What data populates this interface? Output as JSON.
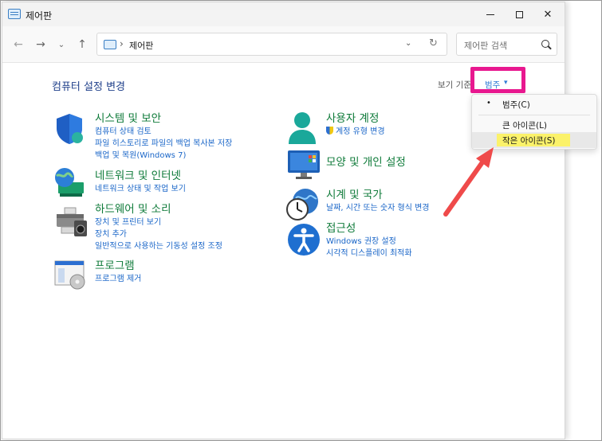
{
  "window": {
    "title": "제어판"
  },
  "nav": {
    "address_path": "제어판",
    "search_placeholder": "제어판 검색"
  },
  "main": {
    "heading": "컴퓨터 설정 변경",
    "view_by_label": "보기 기준:",
    "view_by_value": "범주"
  },
  "categories_left": [
    {
      "title": "시스템 및 보안",
      "links": [
        "컴퓨터 상태 검토",
        "파일 히스토리로 파일의 백업 복사본 저장",
        "백업 및 복원(Windows 7)"
      ]
    },
    {
      "title": "네트워크 및 인터넷",
      "links": [
        "네트워크 상태 및 작업 보기"
      ]
    },
    {
      "title": "하드웨어 및 소리",
      "links": [
        "장치 및 프린터 보기",
        "장치 추가",
        "일반적으로 사용하는 기동성 설정 조정"
      ]
    },
    {
      "title": "프로그램",
      "links": [
        "프로그램 제거"
      ]
    }
  ],
  "categories_right": [
    {
      "title": "사용자 계정",
      "links": [
        "계정 유형 변경"
      ]
    },
    {
      "title": "모양 및 개인 설정",
      "links": []
    },
    {
      "title": "시계 및 국가",
      "links": [
        "날짜, 시간 또는 숫자 형식 변경"
      ]
    },
    {
      "title": "접근성",
      "links": [
        "Windows 권장 설정",
        "시각적 디스플레이 최적화"
      ]
    }
  ],
  "view_menu": {
    "items": [
      {
        "label": "범주(C)",
        "selected": true
      },
      {
        "label": "큰 아이콘(L)",
        "selected": false
      },
      {
        "label": "작은 아이콘(S)",
        "selected": false
      }
    ],
    "selected_marker": "•"
  },
  "colors": {
    "category_title": "#0f7b3a",
    "link": "#1a66c8",
    "heading": "#1e3f8a",
    "annotation_box": "#e8188f",
    "annotation_arrow": "#ef4a4a",
    "annotation_highlight": "#fbf26a"
  },
  "icons": {
    "back": "←",
    "forward": "→",
    "recent": "⌄",
    "up": "↑",
    "separator": "›",
    "dropdown": "⌄",
    "refresh": "↻",
    "caret": "▾"
  }
}
